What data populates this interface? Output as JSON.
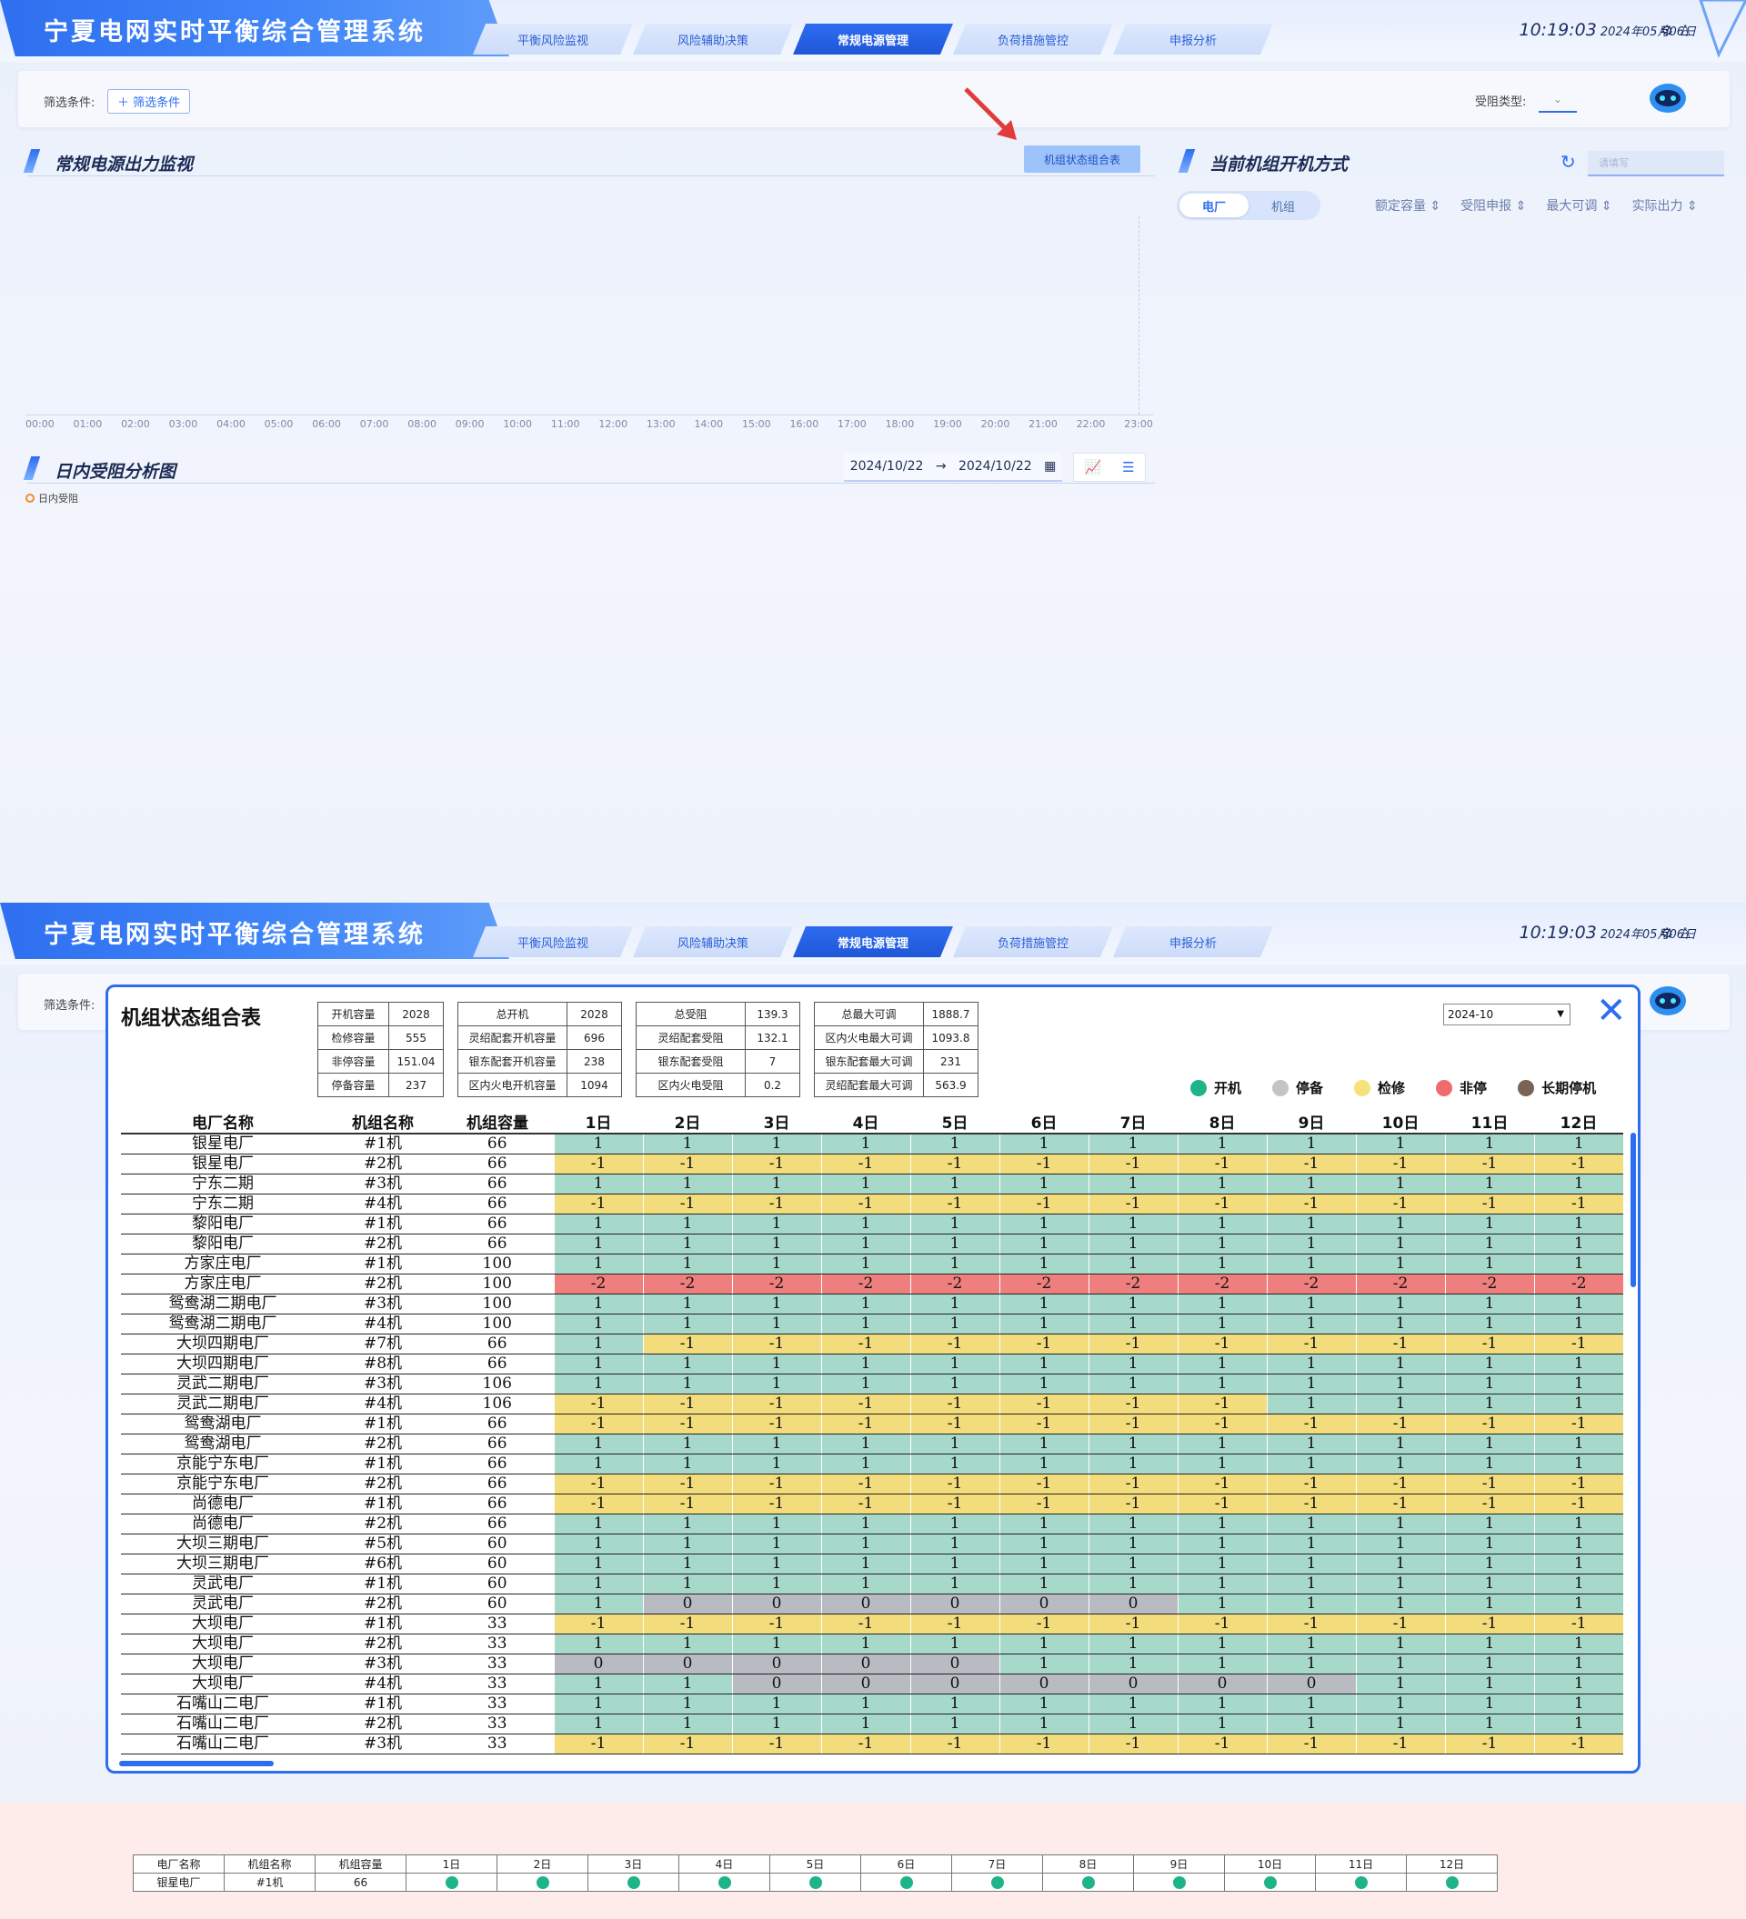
{
  "app": {
    "title": "宁夏电网实时平衡综合管理系统",
    "tabs": [
      "平衡风险监视",
      "风险辅助决策",
      "常规电源管理",
      "负荷措施管控",
      "申报分析"
    ],
    "active_tab_index": 2,
    "time": "10:19:03",
    "date": "2024年05月06日",
    "accent_color": "#2d6ef0"
  },
  "filter": {
    "label": "筛选条件:",
    "add_label": "＋ 筛选条件",
    "type_label": "受阻类型:",
    "type_placeholder": "⌄"
  },
  "sections": {
    "power_monitor": "常规电源出力监视",
    "unit_state_button": "机组状态组合表",
    "intraday_title": "日内受阻分析图",
    "date_start": "2024/10/22",
    "date_arrow": "→",
    "date_end": "2024/10/22",
    "legend_intraday": "日内受阻",
    "unit_mode_title": "当前机组开机方式",
    "search_placeholder": "请填写",
    "toggle_plant": "电厂",
    "toggle_unit": "机组",
    "col_heads": [
      "额定容量 ⇕",
      "受阻申报 ⇕",
      "最大可调 ⇕",
      "实际出力 ⇕"
    ]
  },
  "axis_times": [
    "00:00",
    "01:00",
    "02:00",
    "03:00",
    "04:00",
    "05:00",
    "06:00",
    "07:00",
    "08:00",
    "09:00",
    "10:00",
    "11:00",
    "12:00",
    "13:00",
    "14:00",
    "15:00",
    "16:00",
    "17:00",
    "18:00",
    "19:00",
    "20:00",
    "21:00",
    "22:00",
    "23:00"
  ],
  "modal": {
    "title": "机组状态组合表",
    "month": "2024-10",
    "close": "✕",
    "summary": [
      [
        "开机容量",
        "2028",
        "总开机",
        "2028",
        "总受阻",
        "139.3",
        "总最大可调",
        "1888.7"
      ],
      [
        "检修容量",
        "555",
        "灵绍配套开机容量",
        "696",
        "灵绍配套受阻",
        "132.1",
        "区内火电最大可调",
        "1093.8"
      ],
      [
        "非停容量",
        "151.04",
        "银东配套开机容量",
        "238",
        "银东配套受阻",
        "7",
        "银东配套最大可调",
        "231"
      ],
      [
        "停备容量",
        "237",
        "区内火电开机容量",
        "1094",
        "区内火电受阻",
        "0.2",
        "灵绍配套最大可调",
        "563.9"
      ]
    ],
    "legend": [
      {
        "label": "开机",
        "color": "#1fb38a"
      },
      {
        "label": "停备",
        "color": "#c4c4c8"
      },
      {
        "label": "检修",
        "color": "#f6e27a"
      },
      {
        "label": "非停",
        "color": "#f06b6b"
      },
      {
        "label": "长期停机",
        "color": "#7a6355"
      }
    ],
    "headers": [
      "电厂名称",
      "机组名称",
      "机组容量",
      "1日",
      "2日",
      "3日",
      "4日",
      "5日",
      "6日",
      "7日",
      "8日",
      "9日",
      "10日",
      "11日",
      "12日"
    ],
    "rows": [
      [
        "银星电厂",
        "#1机",
        "66",
        [
          1,
          1,
          1,
          1,
          1,
          1,
          1,
          1,
          1,
          1,
          1,
          1
        ]
      ],
      [
        "银星电厂",
        "#2机",
        "66",
        [
          -1,
          -1,
          -1,
          -1,
          -1,
          -1,
          -1,
          -1,
          -1,
          -1,
          -1,
          -1
        ]
      ],
      [
        "宁东二期",
        "#3机",
        "66",
        [
          1,
          1,
          1,
          1,
          1,
          1,
          1,
          1,
          1,
          1,
          1,
          1
        ]
      ],
      [
        "宁东二期",
        "#4机",
        "66",
        [
          -1,
          -1,
          -1,
          -1,
          -1,
          -1,
          -1,
          -1,
          -1,
          -1,
          -1,
          -1
        ]
      ],
      [
        "黎阳电厂",
        "#1机",
        "66",
        [
          1,
          1,
          1,
          1,
          1,
          1,
          1,
          1,
          1,
          1,
          1,
          1
        ]
      ],
      [
        "黎阳电厂",
        "#2机",
        "66",
        [
          1,
          1,
          1,
          1,
          1,
          1,
          1,
          1,
          1,
          1,
          1,
          1
        ]
      ],
      [
        "方家庄电厂",
        "#1机",
        "100",
        [
          1,
          1,
          1,
          1,
          1,
          1,
          1,
          1,
          1,
          1,
          1,
          1
        ]
      ],
      [
        "方家庄电厂",
        "#2机",
        "100",
        [
          -2,
          -2,
          -2,
          -2,
          -2,
          -2,
          -2,
          -2,
          -2,
          -2,
          -2,
          -2
        ]
      ],
      [
        "鸳鸯湖二期电厂",
        "#3机",
        "100",
        [
          1,
          1,
          1,
          1,
          1,
          1,
          1,
          1,
          1,
          1,
          1,
          1
        ]
      ],
      [
        "鸳鸯湖二期电厂",
        "#4机",
        "100",
        [
          1,
          1,
          1,
          1,
          1,
          1,
          1,
          1,
          1,
          1,
          1,
          1
        ]
      ],
      [
        "大坝四期电厂",
        "#7机",
        "66",
        [
          1,
          -1,
          -1,
          -1,
          -1,
          -1,
          -1,
          -1,
          -1,
          -1,
          -1,
          -1
        ]
      ],
      [
        "大坝四期电厂",
        "#8机",
        "66",
        [
          1,
          1,
          1,
          1,
          1,
          1,
          1,
          1,
          1,
          1,
          1,
          1
        ]
      ],
      [
        "灵武二期电厂",
        "#3机",
        "106",
        [
          1,
          1,
          1,
          1,
          1,
          1,
          1,
          1,
          1,
          1,
          1,
          1
        ]
      ],
      [
        "灵武二期电厂",
        "#4机",
        "106",
        [
          -1,
          -1,
          -1,
          -1,
          -1,
          -1,
          -1,
          -1,
          1,
          1,
          1,
          1
        ]
      ],
      [
        "鸳鸯湖电厂",
        "#1机",
        "66",
        [
          -1,
          -1,
          -1,
          -1,
          -1,
          -1,
          -1,
          -1,
          -1,
          -1,
          -1,
          -1
        ]
      ],
      [
        "鸳鸯湖电厂",
        "#2机",
        "66",
        [
          1,
          1,
          1,
          1,
          1,
          1,
          1,
          1,
          1,
          1,
          1,
          1
        ]
      ],
      [
        "京能宁东电厂",
        "#1机",
        "66",
        [
          1,
          1,
          1,
          1,
          1,
          1,
          1,
          1,
          1,
          1,
          1,
          1
        ]
      ],
      [
        "京能宁东电厂",
        "#2机",
        "66",
        [
          -1,
          -1,
          -1,
          -1,
          -1,
          -1,
          -1,
          -1,
          -1,
          -1,
          -1,
          -1
        ]
      ],
      [
        "尚德电厂",
        "#1机",
        "66",
        [
          -1,
          -1,
          -1,
          -1,
          -1,
          -1,
          -1,
          -1,
          -1,
          -1,
          -1,
          -1
        ]
      ],
      [
        "尚德电厂",
        "#2机",
        "66",
        [
          1,
          1,
          1,
          1,
          1,
          1,
          1,
          1,
          1,
          1,
          1,
          1
        ]
      ],
      [
        "大坝三期电厂",
        "#5机",
        "60",
        [
          1,
          1,
          1,
          1,
          1,
          1,
          1,
          1,
          1,
          1,
          1,
          1
        ]
      ],
      [
        "大坝三期电厂",
        "#6机",
        "60",
        [
          1,
          1,
          1,
          1,
          1,
          1,
          1,
          1,
          1,
          1,
          1,
          1
        ]
      ],
      [
        "灵武电厂",
        "#1机",
        "60",
        [
          1,
          1,
          1,
          1,
          1,
          1,
          1,
          1,
          1,
          1,
          1,
          1
        ]
      ],
      [
        "灵武电厂",
        "#2机",
        "60",
        [
          1,
          0,
          0,
          0,
          0,
          0,
          0,
          1,
          1,
          1,
          1,
          1
        ]
      ],
      [
        "大坝电厂",
        "#1机",
        "33",
        [
          -1,
          -1,
          -1,
          -1,
          -1,
          -1,
          -1,
          -1,
          -1,
          -1,
          -1,
          -1
        ]
      ],
      [
        "大坝电厂",
        "#2机",
        "33",
        [
          1,
          1,
          1,
          1,
          1,
          1,
          1,
          1,
          1,
          1,
          1,
          1
        ]
      ],
      [
        "大坝电厂",
        "#3机",
        "33",
        [
          0,
          0,
          0,
          0,
          0,
          1,
          1,
          1,
          1,
          1,
          1,
          1
        ]
      ],
      [
        "大坝电厂",
        "#4机",
        "33",
        [
          1,
          1,
          0,
          0,
          0,
          0,
          0,
          0,
          0,
          1,
          1,
          1
        ]
      ],
      [
        "石嘴山二电厂",
        "#1机",
        "33",
        [
          1,
          1,
          1,
          1,
          1,
          1,
          1,
          1,
          1,
          1,
          1,
          1
        ]
      ],
      [
        "石嘴山二电厂",
        "#2机",
        "33",
        [
          1,
          1,
          1,
          1,
          1,
          1,
          1,
          1,
          1,
          1,
          1,
          1
        ]
      ],
      [
        "石嘴山二电厂",
        "#3机",
        "33",
        [
          -1,
          -1,
          -1,
          -1,
          -1,
          -1,
          -1,
          -1,
          -1,
          -1,
          -1,
          -1
        ]
      ]
    ]
  },
  "mini_table": {
    "headers": [
      "电厂名称",
      "机组名称",
      "机组容量",
      "1日",
      "2日",
      "3日",
      "4日",
      "5日",
      "6日",
      "7日",
      "8日",
      "9日",
      "10日",
      "11日",
      "12日"
    ],
    "row": [
      "银星电厂",
      "#1机",
      "66"
    ]
  }
}
